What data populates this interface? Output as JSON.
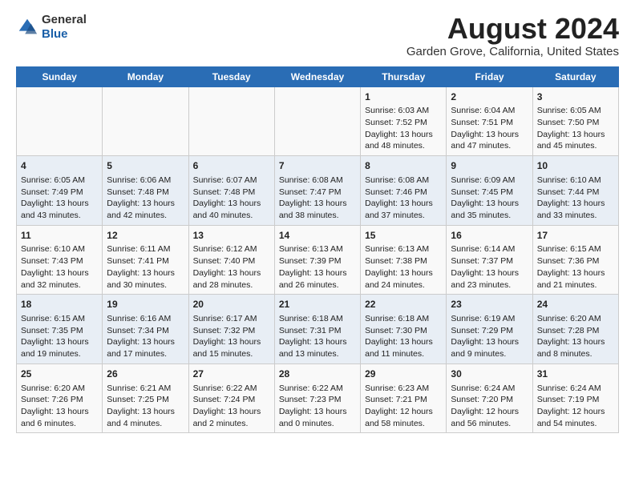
{
  "logo": {
    "general": "General",
    "blue": "Blue"
  },
  "header": {
    "title": "August 2024",
    "subtitle": "Garden Grove, California, United States"
  },
  "calendar": {
    "days_of_week": [
      "Sunday",
      "Monday",
      "Tuesday",
      "Wednesday",
      "Thursday",
      "Friday",
      "Saturday"
    ],
    "weeks": [
      [
        {
          "day": "",
          "info": ""
        },
        {
          "day": "",
          "info": ""
        },
        {
          "day": "",
          "info": ""
        },
        {
          "day": "",
          "info": ""
        },
        {
          "day": "1",
          "info": "Sunrise: 6:03 AM\nSunset: 7:52 PM\nDaylight: 13 hours and 48 minutes."
        },
        {
          "day": "2",
          "info": "Sunrise: 6:04 AM\nSunset: 7:51 PM\nDaylight: 13 hours and 47 minutes."
        },
        {
          "day": "3",
          "info": "Sunrise: 6:05 AM\nSunset: 7:50 PM\nDaylight: 13 hours and 45 minutes."
        }
      ],
      [
        {
          "day": "4",
          "info": "Sunrise: 6:05 AM\nSunset: 7:49 PM\nDaylight: 13 hours and 43 minutes."
        },
        {
          "day": "5",
          "info": "Sunrise: 6:06 AM\nSunset: 7:48 PM\nDaylight: 13 hours and 42 minutes."
        },
        {
          "day": "6",
          "info": "Sunrise: 6:07 AM\nSunset: 7:48 PM\nDaylight: 13 hours and 40 minutes."
        },
        {
          "day": "7",
          "info": "Sunrise: 6:08 AM\nSunset: 7:47 PM\nDaylight: 13 hours and 38 minutes."
        },
        {
          "day": "8",
          "info": "Sunrise: 6:08 AM\nSunset: 7:46 PM\nDaylight: 13 hours and 37 minutes."
        },
        {
          "day": "9",
          "info": "Sunrise: 6:09 AM\nSunset: 7:45 PM\nDaylight: 13 hours and 35 minutes."
        },
        {
          "day": "10",
          "info": "Sunrise: 6:10 AM\nSunset: 7:44 PM\nDaylight: 13 hours and 33 minutes."
        }
      ],
      [
        {
          "day": "11",
          "info": "Sunrise: 6:10 AM\nSunset: 7:43 PM\nDaylight: 13 hours and 32 minutes."
        },
        {
          "day": "12",
          "info": "Sunrise: 6:11 AM\nSunset: 7:41 PM\nDaylight: 13 hours and 30 minutes."
        },
        {
          "day": "13",
          "info": "Sunrise: 6:12 AM\nSunset: 7:40 PM\nDaylight: 13 hours and 28 minutes."
        },
        {
          "day": "14",
          "info": "Sunrise: 6:13 AM\nSunset: 7:39 PM\nDaylight: 13 hours and 26 minutes."
        },
        {
          "day": "15",
          "info": "Sunrise: 6:13 AM\nSunset: 7:38 PM\nDaylight: 13 hours and 24 minutes."
        },
        {
          "day": "16",
          "info": "Sunrise: 6:14 AM\nSunset: 7:37 PM\nDaylight: 13 hours and 23 minutes."
        },
        {
          "day": "17",
          "info": "Sunrise: 6:15 AM\nSunset: 7:36 PM\nDaylight: 13 hours and 21 minutes."
        }
      ],
      [
        {
          "day": "18",
          "info": "Sunrise: 6:15 AM\nSunset: 7:35 PM\nDaylight: 13 hours and 19 minutes."
        },
        {
          "day": "19",
          "info": "Sunrise: 6:16 AM\nSunset: 7:34 PM\nDaylight: 13 hours and 17 minutes."
        },
        {
          "day": "20",
          "info": "Sunrise: 6:17 AM\nSunset: 7:32 PM\nDaylight: 13 hours and 15 minutes."
        },
        {
          "day": "21",
          "info": "Sunrise: 6:18 AM\nSunset: 7:31 PM\nDaylight: 13 hours and 13 minutes."
        },
        {
          "day": "22",
          "info": "Sunrise: 6:18 AM\nSunset: 7:30 PM\nDaylight: 13 hours and 11 minutes."
        },
        {
          "day": "23",
          "info": "Sunrise: 6:19 AM\nSunset: 7:29 PM\nDaylight: 13 hours and 9 minutes."
        },
        {
          "day": "24",
          "info": "Sunrise: 6:20 AM\nSunset: 7:28 PM\nDaylight: 13 hours and 8 minutes."
        }
      ],
      [
        {
          "day": "25",
          "info": "Sunrise: 6:20 AM\nSunset: 7:26 PM\nDaylight: 13 hours and 6 minutes."
        },
        {
          "day": "26",
          "info": "Sunrise: 6:21 AM\nSunset: 7:25 PM\nDaylight: 13 hours and 4 minutes."
        },
        {
          "day": "27",
          "info": "Sunrise: 6:22 AM\nSunset: 7:24 PM\nDaylight: 13 hours and 2 minutes."
        },
        {
          "day": "28",
          "info": "Sunrise: 6:22 AM\nSunset: 7:23 PM\nDaylight: 13 hours and 0 minutes."
        },
        {
          "day": "29",
          "info": "Sunrise: 6:23 AM\nSunset: 7:21 PM\nDaylight: 12 hours and 58 minutes."
        },
        {
          "day": "30",
          "info": "Sunrise: 6:24 AM\nSunset: 7:20 PM\nDaylight: 12 hours and 56 minutes."
        },
        {
          "day": "31",
          "info": "Sunrise: 6:24 AM\nSunset: 7:19 PM\nDaylight: 12 hours and 54 minutes."
        }
      ]
    ]
  }
}
